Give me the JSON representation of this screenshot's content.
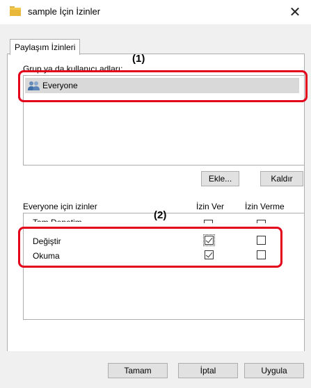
{
  "window": {
    "title": "sample İçin İzinler",
    "close_glyph": "✕"
  },
  "tabs": [
    {
      "label": "Paylaşım İzinleri",
      "active": true
    }
  ],
  "group_users": {
    "label": "Grup ya da kullanıcı adları:",
    "items": [
      {
        "label": "Everyone",
        "icon": "users-icon",
        "selected": true
      }
    ]
  },
  "buttons": {
    "add": "Ekle...",
    "remove": "Kaldır",
    "ok": "Tamam",
    "cancel": "İptal",
    "apply": "Uygula"
  },
  "permissions": {
    "label": "Everyone için izinler",
    "col_allow": "İzin Ver",
    "col_deny": "İzin Verme",
    "partial_row_label": "Tam Denetim",
    "rows": [
      {
        "label": "Değiştir",
        "allow": true,
        "deny": false
      },
      {
        "label": "Okuma",
        "allow": true,
        "deny": false
      }
    ]
  },
  "annotations": {
    "marker1": "(1)",
    "marker2": "(2)",
    "highlight_color": "#e2001a"
  }
}
